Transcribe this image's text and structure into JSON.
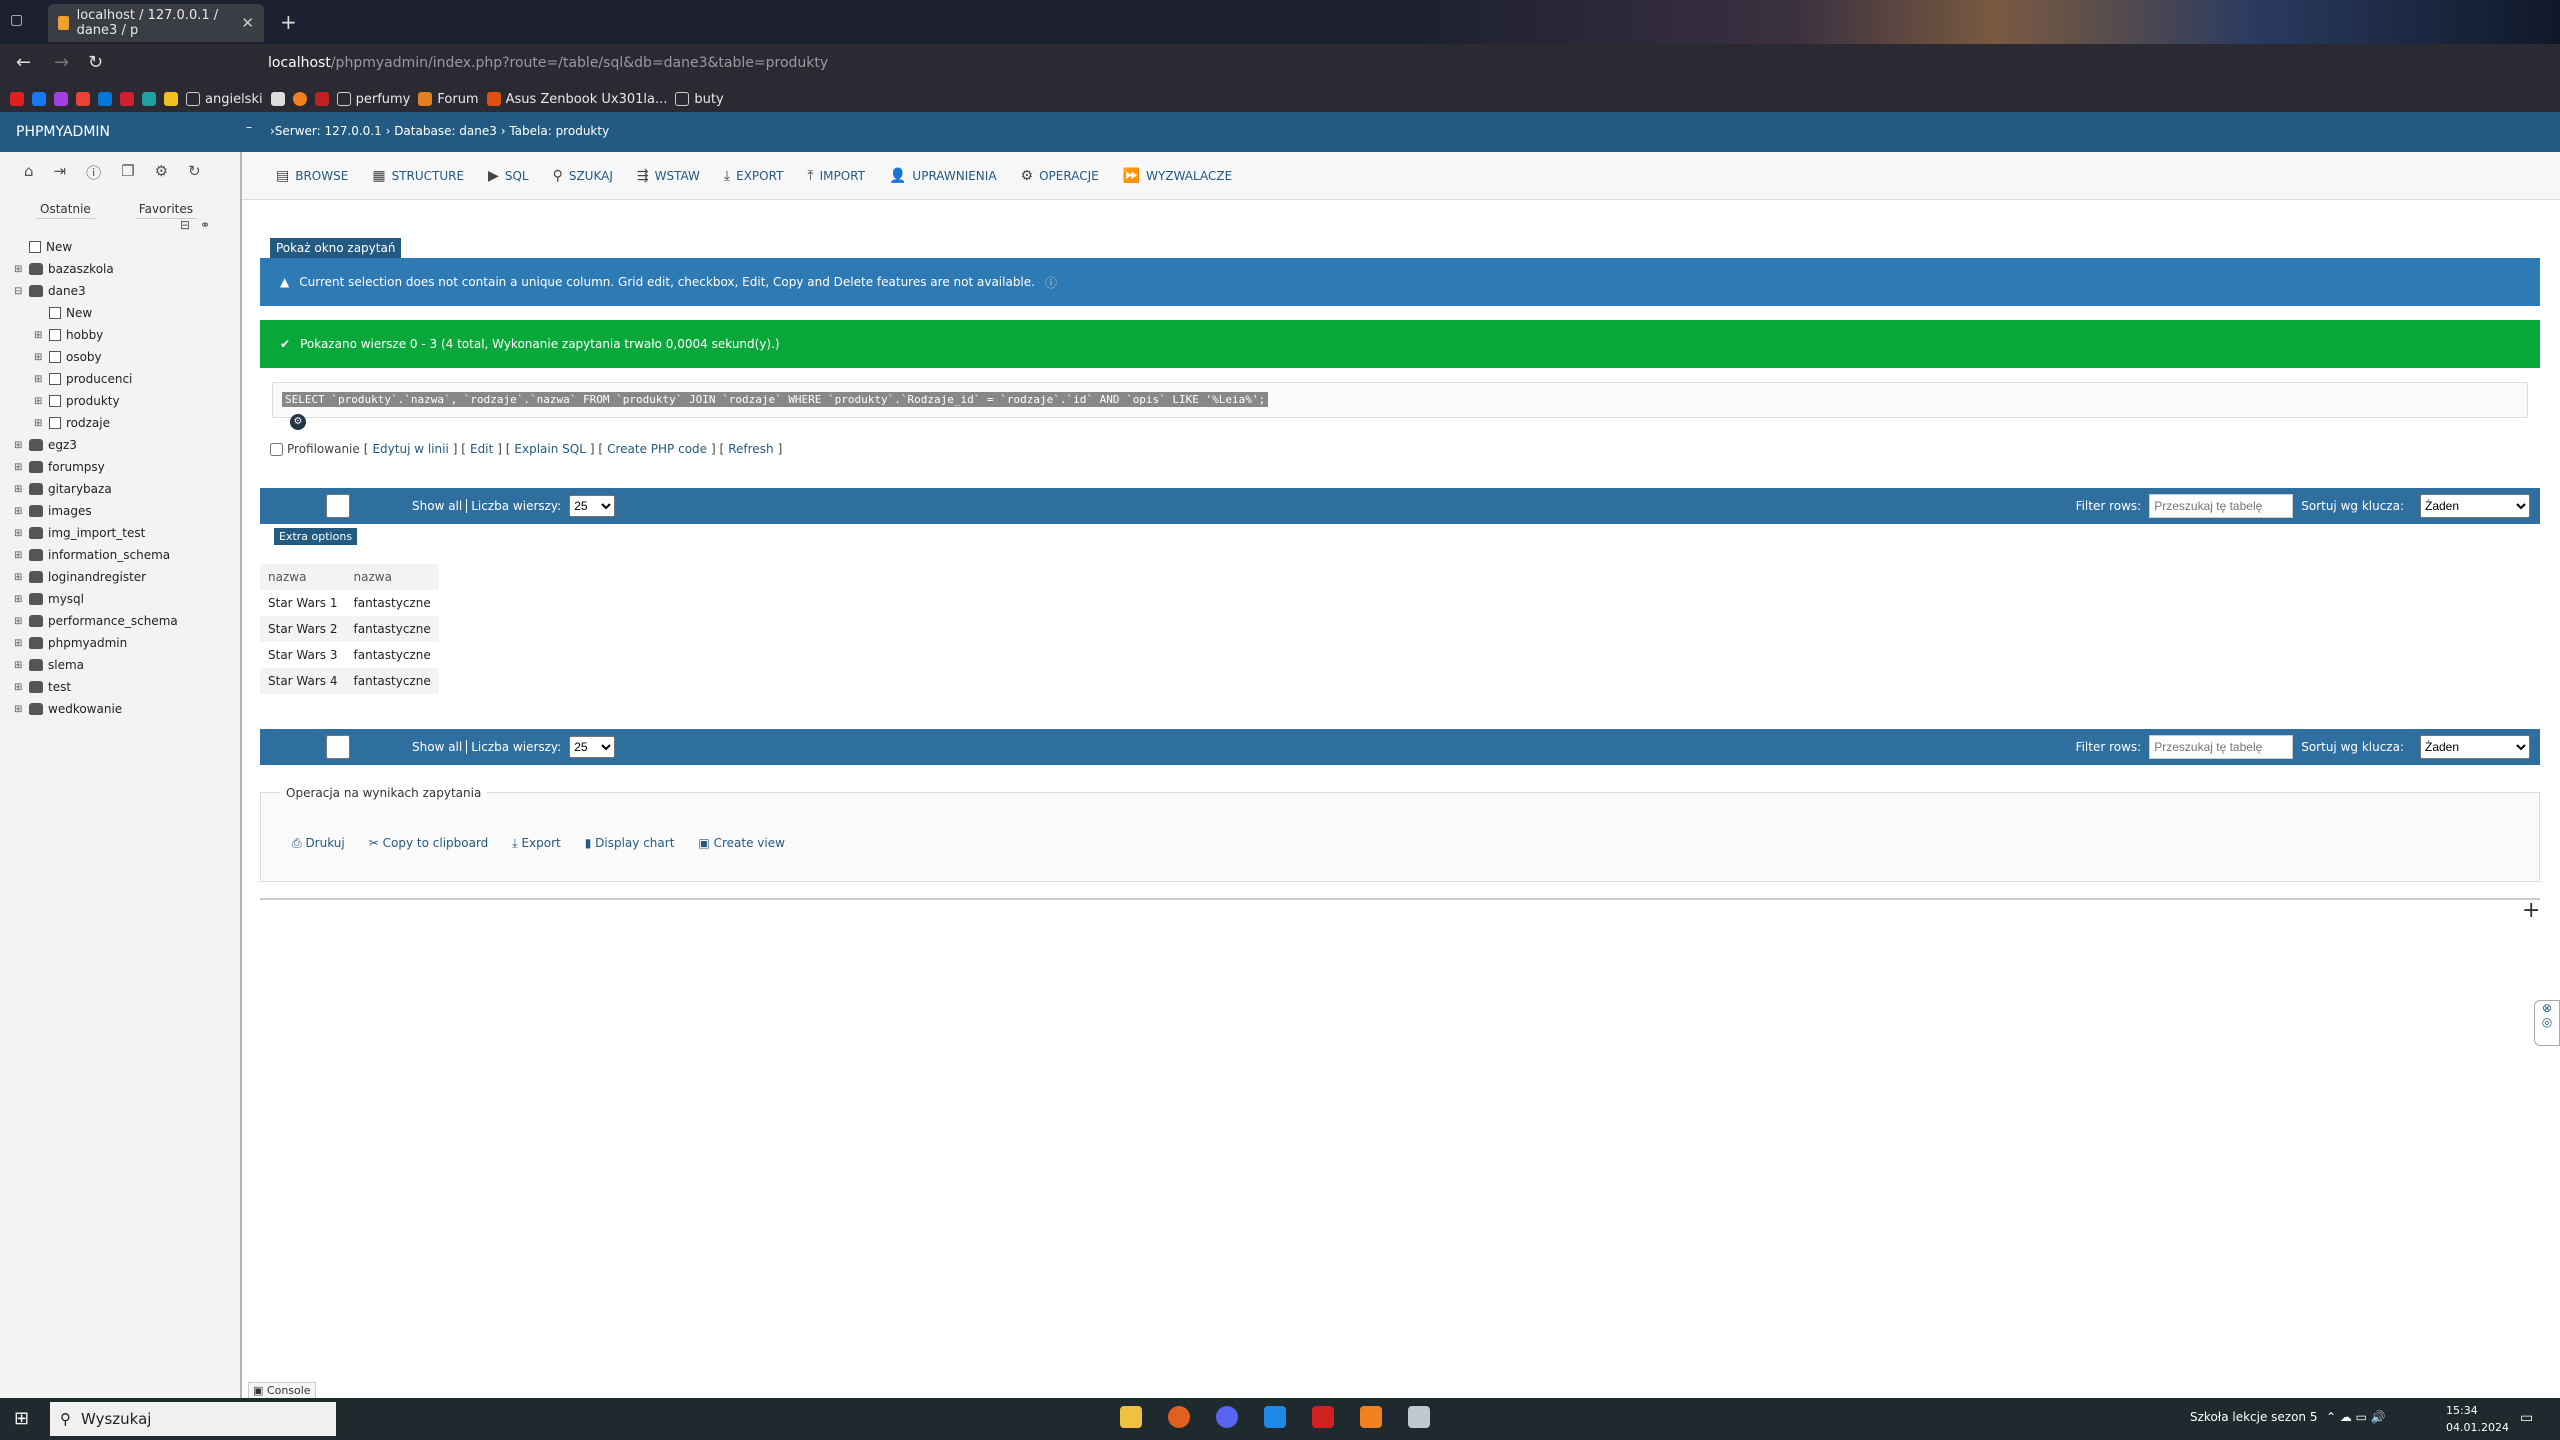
{
  "browser": {
    "tab_title": "localhost / 127.0.0.1 / dane3 / p",
    "url_host": "localhost",
    "url_path": "/phpmyadmin/index.php?route=/table/sql&db=dane3&table=produkty",
    "bookmarks": [
      "angielski",
      "perfumy",
      "Forum",
      "Asus Zenbook Ux301la...",
      "buty"
    ]
  },
  "pma": {
    "logo": "PHPMYADMIN",
    "breadcrumb": "›Serwer: 127.0.0.1  ›  Database: dane3  ›  Tabela: produkty",
    "sidebar_tabs": [
      "Ostatnie",
      "Favorites"
    ],
    "tree": [
      {
        "label": "New",
        "level": 0,
        "type": "new"
      },
      {
        "label": "bazaszkola",
        "level": 0,
        "type": "db"
      },
      {
        "label": "dane3",
        "level": 0,
        "type": "db"
      },
      {
        "label": "New",
        "level": 1,
        "type": "new"
      },
      {
        "label": "hobby",
        "level": 1,
        "type": "tbl"
      },
      {
        "label": "osoby",
        "level": 1,
        "type": "tbl"
      },
      {
        "label": "producenci",
        "level": 1,
        "type": "tbl"
      },
      {
        "label": "produkty",
        "level": 1,
        "type": "tbl"
      },
      {
        "label": "rodzaje",
        "level": 1,
        "type": "tbl"
      },
      {
        "label": "egz3",
        "level": 0,
        "type": "db"
      },
      {
        "label": "forumpsy",
        "level": 0,
        "type": "db"
      },
      {
        "label": "gitarybaza",
        "level": 0,
        "type": "db"
      },
      {
        "label": "images",
        "level": 0,
        "type": "db"
      },
      {
        "label": "img_import_test",
        "level": 0,
        "type": "db"
      },
      {
        "label": "information_schema",
        "level": 0,
        "type": "db"
      },
      {
        "label": "loginandregister",
        "level": 0,
        "type": "db"
      },
      {
        "label": "mysql",
        "level": 0,
        "type": "db"
      },
      {
        "label": "performance_schema",
        "level": 0,
        "type": "db"
      },
      {
        "label": "phpmyadmin",
        "level": 0,
        "type": "db"
      },
      {
        "label": "slema",
        "level": 0,
        "type": "db"
      },
      {
        "label": "test",
        "level": 0,
        "type": "db"
      },
      {
        "label": "wedkowanie",
        "level": 0,
        "type": "db"
      }
    ],
    "nav_tabs": [
      "BROWSE",
      "STRUCTURE",
      "SQL",
      "SZUKAJ",
      "WSTAW",
      "EXPORT",
      "IMPORT",
      "UPRAWNIENIA",
      "OPERACJE",
      "WYZWALACZE"
    ],
    "show_query": "Pokaż okno zapytań",
    "warning": "Current selection does not contain a unique column. Grid edit, checkbox, Edit, Copy and Delete features are not available.",
    "success": "Pokazano wiersze 0 - 3 (4 total, Wykonanie zapytania trwało 0,0004 sekund(y).)",
    "sql": "SELECT `produkty`.`nazwa`, `rodzaje`.`nazwa` FROM `produkty` JOIN `rodzaje` WHERE `produkty`.`Rodzaje_id` = `rodzaje`.`id` AND `opis` LIKE '%Leia%';",
    "profiling": "Profilowanie",
    "links": [
      "Edytuj w linii",
      "Edit",
      "Explain SQL",
      "Create PHP code",
      "Refresh"
    ],
    "show_all": "Show all",
    "rows_label": "Liczba wierszy:",
    "rows_value": "25",
    "filter_label": "Filter rows:",
    "filter_placeholder": "Przeszukaj tę tabelę",
    "sort_label": "Sortuj wg klucza:",
    "sort_value": "Żaden",
    "extra_options": "Extra options",
    "columns": [
      "nazwa",
      "nazwa"
    ],
    "rows": [
      [
        "Star Wars 1",
        "fantastyczne"
      ],
      [
        "Star Wars 2",
        "fantastyczne"
      ],
      [
        "Star Wars 3",
        "fantastyczne"
      ],
      [
        "Star Wars 4",
        "fantastyczne"
      ]
    ],
    "ops_legend": "Operacja na wynikach zapytania",
    "ops": [
      "Drukuj",
      "Copy to clipboard",
      "Export",
      "Display chart",
      "Create view"
    ],
    "console": "Console"
  },
  "taskbar": {
    "search": "Wyszukaj",
    "tray_text": "Szkoła lekcje sezon 5",
    "time": "15:34",
    "date": "04.01.2024"
  }
}
